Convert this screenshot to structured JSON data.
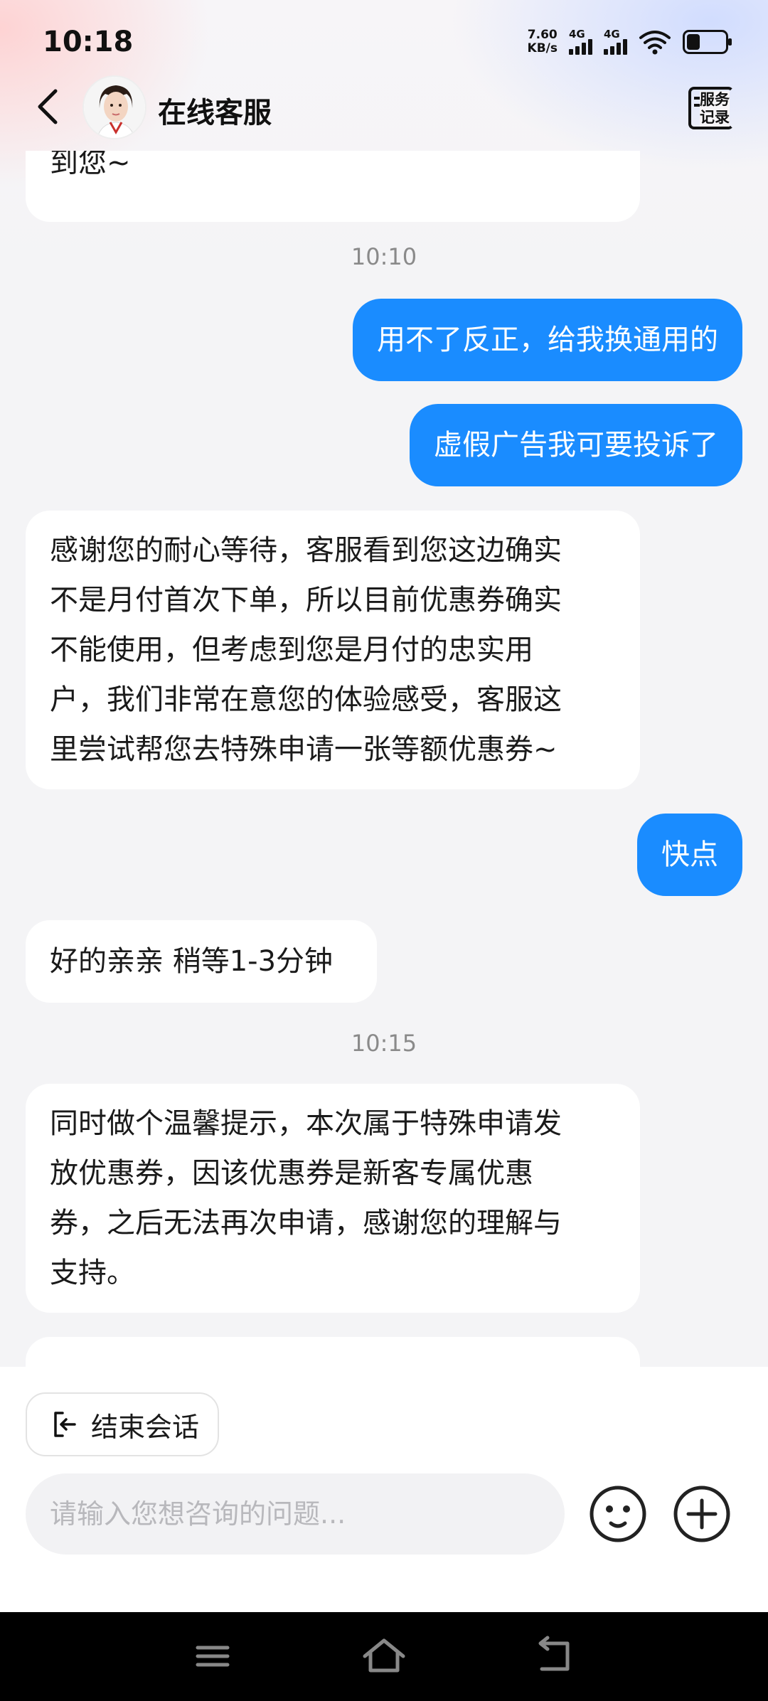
{
  "status_bar": {
    "time": "10:18",
    "net_speed_value": "7.60",
    "net_speed_unit": "KB/s",
    "sim1_label": "4G",
    "sim2_label": "4G"
  },
  "header": {
    "title": "在线客服",
    "service_record_line1": "服务",
    "service_record_line2": "记录"
  },
  "messages": {
    "m0": "到您~",
    "t1": "10:10",
    "m1": "用不了反正，给我换通用的",
    "m2": "虚假广告我可要投诉了",
    "m3_l1": "感谢您的耐心等待，客服看到您这边确实",
    "m3_l2": "不是月付首次下单，所以目前优惠券确实",
    "m3_l3": "不能使用，但考虑到您是月付的忠实用",
    "m3_l4": "户，我们非常在意您的体验感受，客服这",
    "m3_l5": "里尝试帮您去特殊申请一张等额优惠券~",
    "m4": "快点",
    "m5": "好的亲亲 稍等1-3分钟",
    "t2": "10:15",
    "m6_l1": "同时做个温馨提示，本次属于特殊申请发",
    "m6_l2": "放优惠券，因该优惠券是新客专属优惠",
    "m6_l3": "券，之后无法再次申请，感谢您的理解与",
    "m6_l4": "支持。"
  },
  "input_area": {
    "end_session_label": "结束会话",
    "input_placeholder": "请输入您想咨询的问题..."
  },
  "colors": {
    "user_bubble": "#1a8cff",
    "agent_bubble": "#ffffff",
    "page_bg": "#f4f4f6"
  }
}
